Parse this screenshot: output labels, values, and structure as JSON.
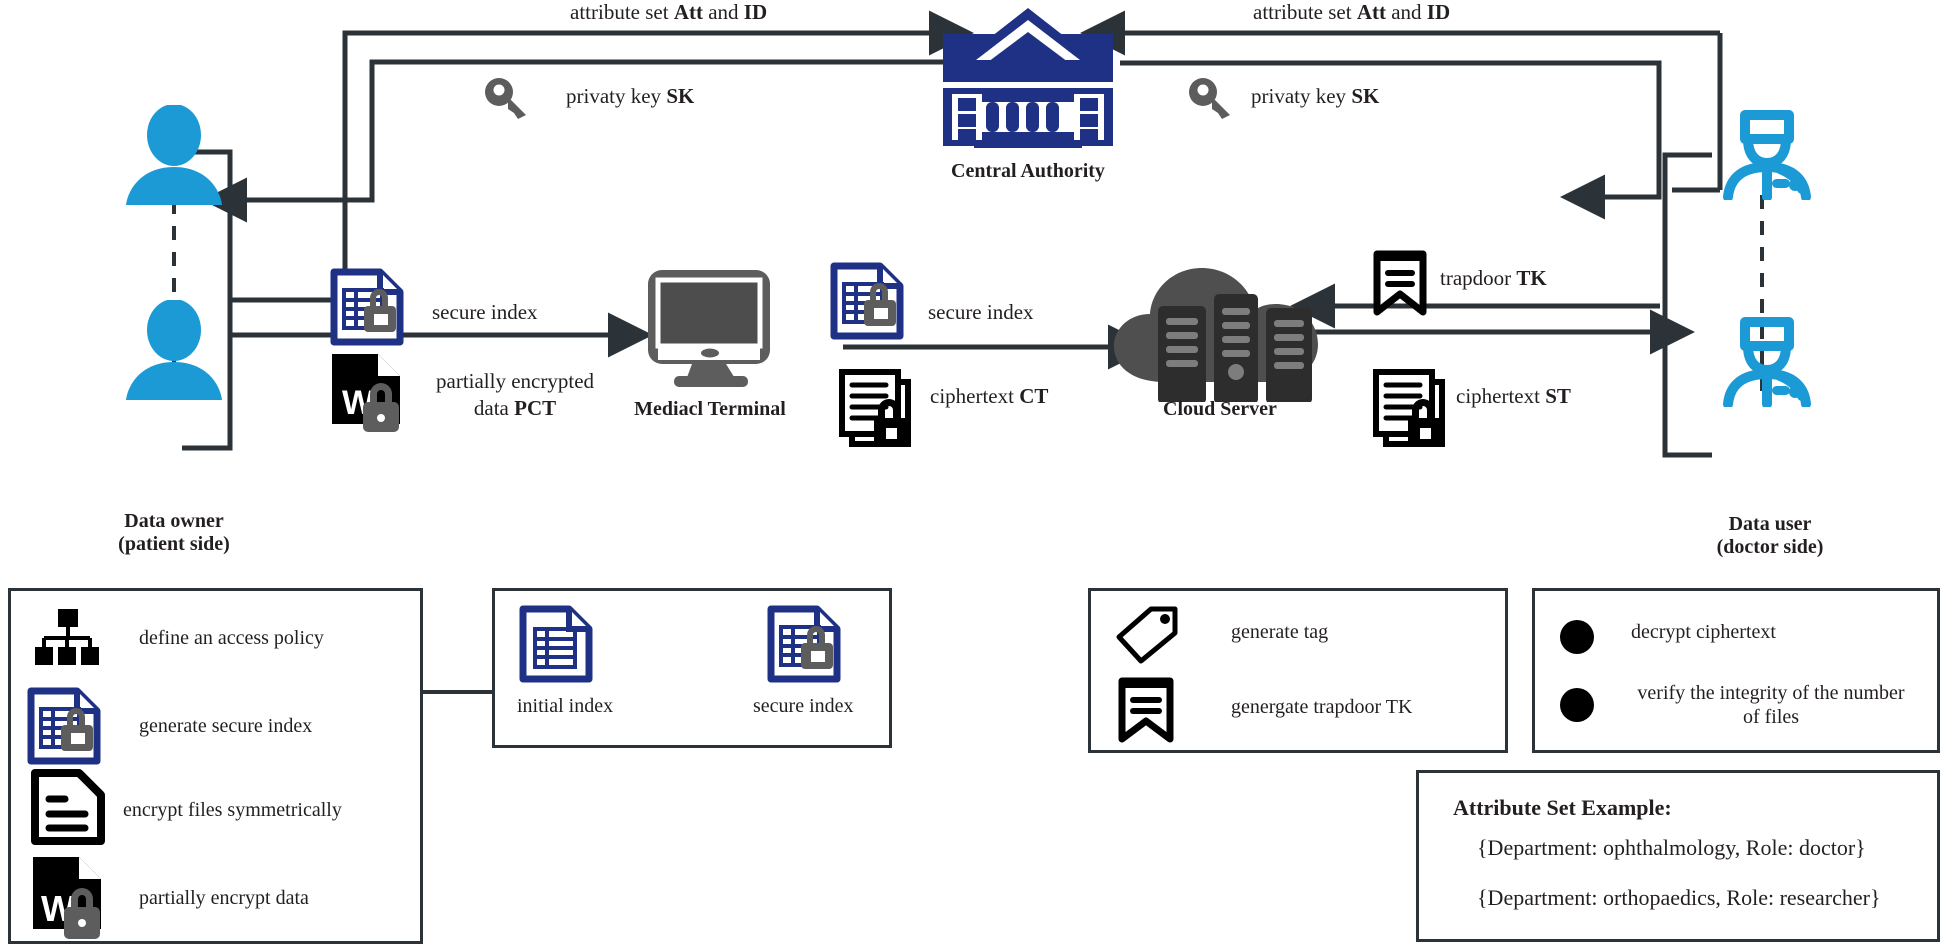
{
  "diagram": {
    "title": "Privacy-preserving medical data sharing system architecture",
    "colors": {
      "person_blue": "#1b9ad6",
      "authority_navy": "#1f3184",
      "index_navy": "#1f3184",
      "line_dark": "#2b3338",
      "icon_gray": "#5d5d5d",
      "cloud_gray": "#4f4f4f",
      "black": "#000000",
      "box_border": "#2b3338"
    },
    "nodes": [
      {
        "id": "data-owner",
        "caption_line1": "Data owner",
        "caption_line2": "(patient side)"
      },
      {
        "id": "central-authority",
        "caption_line1": "Central Authority",
        "caption_line2": ""
      },
      {
        "id": "medical-terminal",
        "caption_line1": "Mediacl Terminal",
        "caption_line2": ""
      },
      {
        "id": "cloud-server",
        "caption_line1": "Cloud Server",
        "caption_line2": ""
      },
      {
        "id": "data-user",
        "caption_line1": "Data user",
        "caption_line2": "(doctor side)"
      }
    ],
    "flows": {
      "attr_left": {
        "text_plain": "attribute set ",
        "text_bold1": "Att",
        "text_mid": " and ",
        "text_bold2": "ID"
      },
      "attr_right": {
        "text_plain": "attribute set ",
        "text_bold1": "Att",
        "text_mid": " and ",
        "text_bold2": "ID"
      },
      "sk_left": {
        "text_plain": "privaty key  ",
        "text_bold1": "SK"
      },
      "sk_right": {
        "text_plain": "privaty key  ",
        "text_bold1": "SK"
      },
      "secure_index_left": {
        "label": "secure index"
      },
      "pct_left": {
        "line1": "partially encrypted",
        "line2_plain": "data ",
        "line2_bold": "PCT"
      },
      "secure_index_mid": {
        "label": "secure index"
      },
      "ct_mid": {
        "text_plain": "ciphertext  ",
        "text_bold1": "CT"
      },
      "tk_right": {
        "text_plain": "trapdoor ",
        "text_bold1": "TK"
      },
      "st_right": {
        "text_plain": "ciphertext  ",
        "text_bold1": "ST"
      }
    },
    "legend_owner": {
      "items": [
        {
          "icon": "org-chart-icon",
          "label": "define an access policy"
        },
        {
          "icon": "secure-index-icon",
          "label": "generate secure index"
        },
        {
          "icon": "document-lines-icon",
          "label": "encrypt files symmetrically"
        },
        {
          "icon": "word-doc-lock-icon",
          "label": "partially encrypt data"
        }
      ]
    },
    "legend_index": {
      "left_icon": "initial-index-icon",
      "left_label": "initial index",
      "right_icon": "secure-index-icon",
      "right_label": "secure index"
    },
    "legend_cloud": {
      "items": [
        {
          "icon": "tag-icon",
          "label": "generate tag"
        },
        {
          "icon": "bookmark-icon",
          "label": "genergate trapdoor TK"
        }
      ]
    },
    "legend_user": {
      "items": [
        {
          "icon": "bullet-dot-icon",
          "label": "decrypt ciphertext"
        },
        {
          "icon": "bullet-dot-icon",
          "label": "verify the integrity of the number of files"
        }
      ]
    },
    "attribute_example": {
      "title": "Attribute Set Example:",
      "rows": [
        "{Department: ophthalmology, Role: doctor}",
        "{Department: orthopaedics,  Role: researcher}"
      ]
    }
  }
}
